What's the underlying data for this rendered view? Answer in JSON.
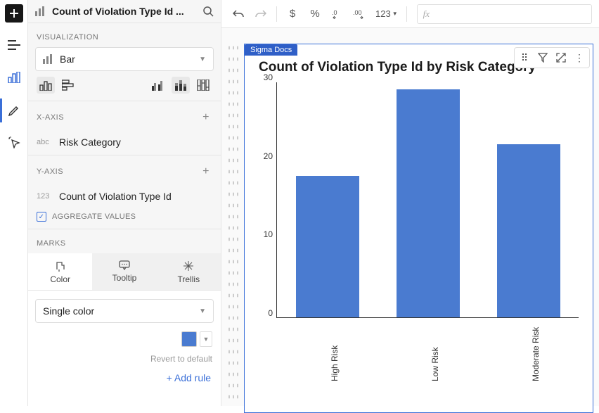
{
  "header": {
    "title": "Count of Violation Type Id ..."
  },
  "visualization": {
    "section_label": "VISUALIZATION",
    "chart_type": "Bar"
  },
  "x_axis": {
    "label": "X-AXIS",
    "field": "Risk Category",
    "type": "abc"
  },
  "y_axis": {
    "label": "Y-AXIS",
    "field": "Count of Violation Type Id",
    "type": "123",
    "aggregate_label": "AGGREGATE VALUES"
  },
  "marks": {
    "label": "MARKS",
    "tabs": {
      "color": "Color",
      "tooltip": "Tooltip",
      "trellis": "Trellis"
    },
    "color_mode": "Single color",
    "swatch": "#4a7bd0",
    "revert": "Revert to default",
    "add_rule": "+  Add rule"
  },
  "formula_prefix": "fx",
  "canvas": {
    "tag": "Sigma Docs",
    "title": "Count of Violation Type Id by Risk Category"
  },
  "toolbar": {
    "dollar": "$",
    "percent": "%",
    "num": "123"
  },
  "chart_data": {
    "type": "bar",
    "title": "Count of Violation Type Id by Risk Category",
    "categories": [
      "High Risk",
      "Low Risk",
      "Moderate Risk"
    ],
    "values": [
      18,
      29,
      22
    ],
    "ylim": [
      0,
      30
    ],
    "yticks": [
      0,
      10,
      20,
      30
    ],
    "xlabel": "",
    "ylabel": ""
  }
}
